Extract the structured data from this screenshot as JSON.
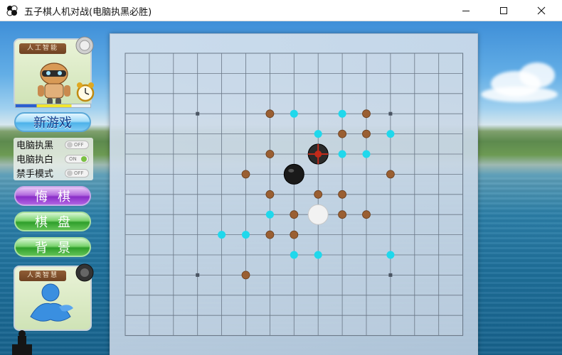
{
  "window": {
    "title": "五子棋人机对战(电脑执黑必胜)",
    "controls": {
      "minimize": "minimize",
      "maximize": "maximize",
      "close": "close"
    }
  },
  "ai_panel": {
    "header": "人工智能",
    "avatar_icon": "robot-icon",
    "clock_icon": "alarm-clock-icon",
    "timer_fraction_blue": 0.28,
    "timer_fraction_yellow": 0.47
  },
  "buttons": {
    "new_game": "新游戏",
    "undo": "悔棋",
    "board": "棋盘",
    "background": "背景"
  },
  "options": [
    {
      "label": "电脑执黑",
      "toggle": "OFF",
      "state": false
    },
    {
      "label": "电脑执白",
      "toggle": "ON",
      "state": true
    },
    {
      "label": "禁手模式",
      "toggle": "OFF",
      "state": false
    }
  ],
  "human_panel": {
    "header": "人类智慧",
    "avatar_icon": "person-icon"
  },
  "board": {
    "size": 15,
    "star_points": [
      [
        3,
        3
      ],
      [
        11,
        3
      ],
      [
        3,
        11
      ],
      [
        11,
        11
      ]
    ],
    "black_stones": [
      [
        7,
        6
      ]
    ],
    "white_stones": [
      [
        8,
        8
      ]
    ],
    "last_move": [
      8,
      5
    ],
    "brown_markers": [
      [
        6,
        3
      ],
      [
        10,
        3
      ],
      [
        9,
        4
      ],
      [
        10,
        4
      ],
      [
        6,
        5
      ],
      [
        5,
        6
      ],
      [
        7,
        6
      ],
      [
        11,
        6
      ],
      [
        6,
        7
      ],
      [
        8,
        7
      ],
      [
        9,
        7
      ],
      [
        7,
        8
      ],
      [
        9,
        8
      ],
      [
        10,
        8
      ],
      [
        6,
        9
      ],
      [
        7,
        9
      ],
      [
        5,
        11
      ]
    ],
    "cyan_markers": [
      [
        7,
        3
      ],
      [
        9,
        3
      ],
      [
        8,
        4
      ],
      [
        11,
        4
      ],
      [
        9,
        5
      ],
      [
        10,
        5
      ],
      [
        6,
        8
      ],
      [
        4,
        9
      ],
      [
        5,
        9
      ],
      [
        7,
        10
      ],
      [
        8,
        10
      ],
      [
        11,
        10
      ]
    ],
    "colors": {
      "grid": "#6a7786",
      "brown": "#9a5f32",
      "cyan": "#1fd8ec",
      "black": "#1a1a1a",
      "white": "#f2f2f2",
      "last_move": "#c22a1a"
    }
  }
}
